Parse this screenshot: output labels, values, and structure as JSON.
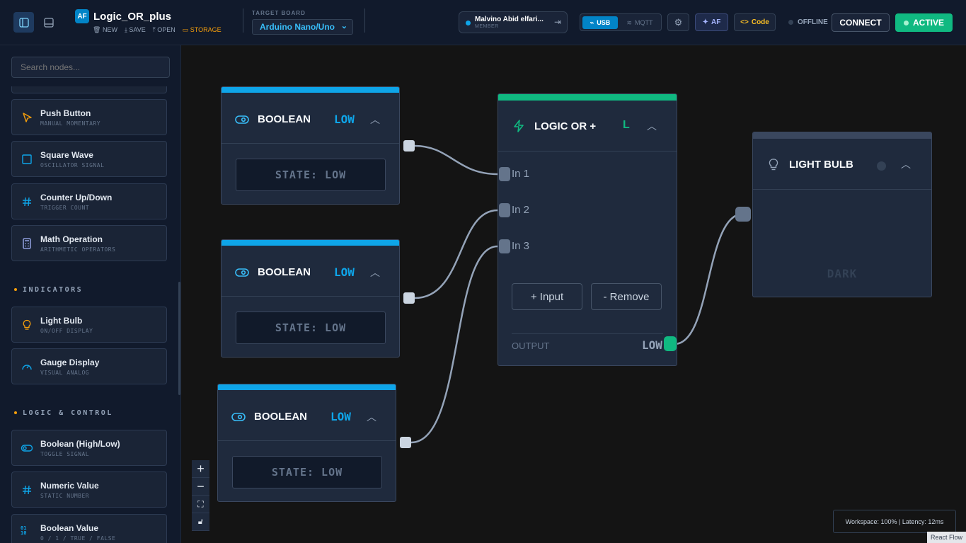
{
  "header": {
    "logo": "AF",
    "project": "Logic_OR_plus",
    "actions": {
      "new": "NEW",
      "save": "SAVE",
      "open": "OPEN",
      "storage": "STORAGE"
    },
    "target_label": "TARGET BOARD",
    "board": "Arduino Nano/Uno",
    "user_name": "Malvino Abid elfari...",
    "user_role": "MEMBER",
    "usb": "USB",
    "mqtt": "MQTT",
    "af": "AF",
    "code": "Code",
    "offline": "OFFLINE",
    "connect": "CONNECT",
    "active": "ACTIVE"
  },
  "sidebar": {
    "search_placeholder": "Search nodes...",
    "items_a": [
      {
        "title": "Push Button",
        "sub": "MANUAL MOMENTARY",
        "icon": "cursor-icon"
      },
      {
        "title": "Square Wave",
        "sub": "OSCILLATOR SIGNAL",
        "icon": "square-wave-icon"
      },
      {
        "title": "Counter Up/Down",
        "sub": "TRIGGER COUNT",
        "icon": "hash-icon"
      },
      {
        "title": "Math Operation",
        "sub": "ARITHMETIC OPERATORS",
        "icon": "calculator-icon"
      }
    ],
    "sec_indicators": "INDICATORS",
    "items_b": [
      {
        "title": "Light Bulb",
        "sub": "ON/OFF DISPLAY",
        "icon": "bulb-icon"
      },
      {
        "title": "Gauge Display",
        "sub": "VISUAL ANALOG",
        "icon": "gauge-icon"
      }
    ],
    "sec_logic": "LOGIC & CONTROL",
    "items_c": [
      {
        "title": "Boolean (High/Low)",
        "sub": "TOGGLE SIGNAL",
        "icon": "toggle-icon"
      },
      {
        "title": "Numeric Value",
        "sub": "STATIC NUMBER",
        "icon": "hash-icon"
      },
      {
        "title": "Boolean Value",
        "sub": "0 / 1 / TRUE / FALSE",
        "icon": "binary-icon"
      }
    ]
  },
  "nodes": {
    "bool1": {
      "title": "BOOLEAN",
      "value": "LOW",
      "state": "STATE: LOW"
    },
    "bool2": {
      "title": "BOOLEAN",
      "value": "LOW",
      "state": "STATE: LOW"
    },
    "bool3": {
      "title": "BOOLEAN",
      "value": "LOW",
      "state": "STATE: LOW"
    },
    "logic": {
      "title": "LOGIC OR +",
      "badge": "L",
      "inputs": [
        "In 1",
        "In 2",
        "In 3"
      ],
      "add_input": "+ Input",
      "remove": "- Remove",
      "output_label": "OUTPUT",
      "output_value": "LOW"
    },
    "bulb": {
      "title": "LIGHT BULB",
      "state": "DARK"
    }
  },
  "status": {
    "text": "Workspace: 100% | Latency: 12ms"
  },
  "attribution": "React Flow",
  "colors": {
    "accent_blue": "#0ea5e9",
    "accent_green": "#10b981",
    "amber": "#f59e0b",
    "bg": "#141414",
    "panel": "#111a2c"
  }
}
